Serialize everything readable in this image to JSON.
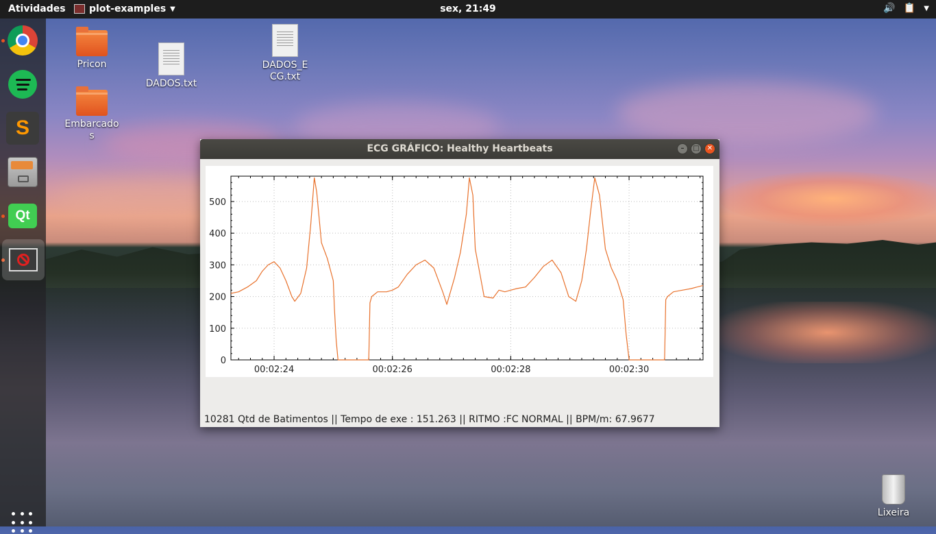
{
  "topbar": {
    "activities": "Atividades",
    "app_menu": "plot-examples",
    "clock": "sex, 21:49",
    "icons": [
      "volume-icon",
      "clipboard-icon",
      "system-menu-icon"
    ]
  },
  "dock": {
    "apps": [
      "chrome",
      "spotify",
      "sublime-text",
      "files",
      "qt-creator",
      "ecg-app"
    ]
  },
  "desktop": {
    "icons": [
      {
        "label": "Pricon",
        "type": "folder"
      },
      {
        "label": "DADOS.txt",
        "type": "text-file"
      },
      {
        "label": "DADOS_ECG.txt",
        "type": "text-file"
      },
      {
        "label": "Embarcados",
        "type": "folder"
      },
      {
        "label": "Lixeira",
        "type": "trash"
      }
    ]
  },
  "window": {
    "title": "ECG GRÁFICO: Healthy Heartbeats",
    "status": "10281 Qtd de Batimentos || Tempo de exe : 151.263  ||  RITMO :FC NORMAL || BPM/m: 67.9677"
  },
  "colors": {
    "line": "#e8702a",
    "close_button": "#e9541f",
    "accent": "#e95420"
  },
  "chart_data": {
    "type": "line",
    "title": "",
    "xlabel": "",
    "ylabel": "",
    "ylim": [
      0,
      580
    ],
    "yticks": [
      0,
      100,
      200,
      300,
      400,
      500
    ],
    "xlim": [
      143.27,
      151.25
    ],
    "xticks": [
      {
        "value": 144,
        "label": "00:02:24"
      },
      {
        "value": 146,
        "label": "00:02:26"
      },
      {
        "value": 148,
        "label": "00:02:28"
      },
      {
        "value": 150,
        "label": "00:02:30"
      }
    ],
    "grid": true,
    "series": [
      {
        "x": [
          143.27,
          143.4,
          143.55,
          143.7,
          143.8,
          143.9,
          144.0,
          144.1,
          144.2,
          144.3,
          144.35,
          144.45,
          144.55,
          144.62,
          144.68,
          144.72,
          144.8,
          144.9,
          145.0,
          145.02,
          145.05,
          145.08,
          145.6,
          145.62,
          145.65,
          145.75,
          145.9,
          146.0,
          146.1,
          146.25,
          146.4,
          146.55,
          146.7,
          146.85,
          146.92,
          147.05,
          147.15,
          147.25,
          147.3,
          147.36,
          147.4,
          147.48,
          147.55,
          147.7,
          147.8,
          147.9,
          148.0,
          148.1,
          148.25,
          148.4,
          148.55,
          148.7,
          148.85,
          148.98,
          149.1,
          149.2,
          149.28,
          149.35,
          149.42,
          149.5,
          149.6,
          149.7,
          149.8,
          149.9,
          149.95,
          150.0,
          150.02,
          150.05,
          150.6,
          150.62,
          150.65,
          150.75,
          150.9,
          151.05,
          151.25
        ],
        "y": [
          210,
          215,
          230,
          250,
          280,
          300,
          310,
          290,
          250,
          200,
          185,
          210,
          290,
          430,
          575,
          530,
          370,
          320,
          250,
          160,
          60,
          0,
          0,
          180,
          200,
          215,
          215,
          220,
          230,
          270,
          300,
          315,
          290,
          215,
          175,
          260,
          340,
          460,
          575,
          520,
          350,
          270,
          200,
          195,
          220,
          215,
          220,
          225,
          230,
          260,
          295,
          315,
          275,
          200,
          185,
          250,
          350,
          470,
          575,
          520,
          350,
          290,
          250,
          190,
          80,
          0,
          0,
          0,
          0,
          190,
          200,
          215,
          220,
          225,
          235
        ]
      }
    ]
  }
}
